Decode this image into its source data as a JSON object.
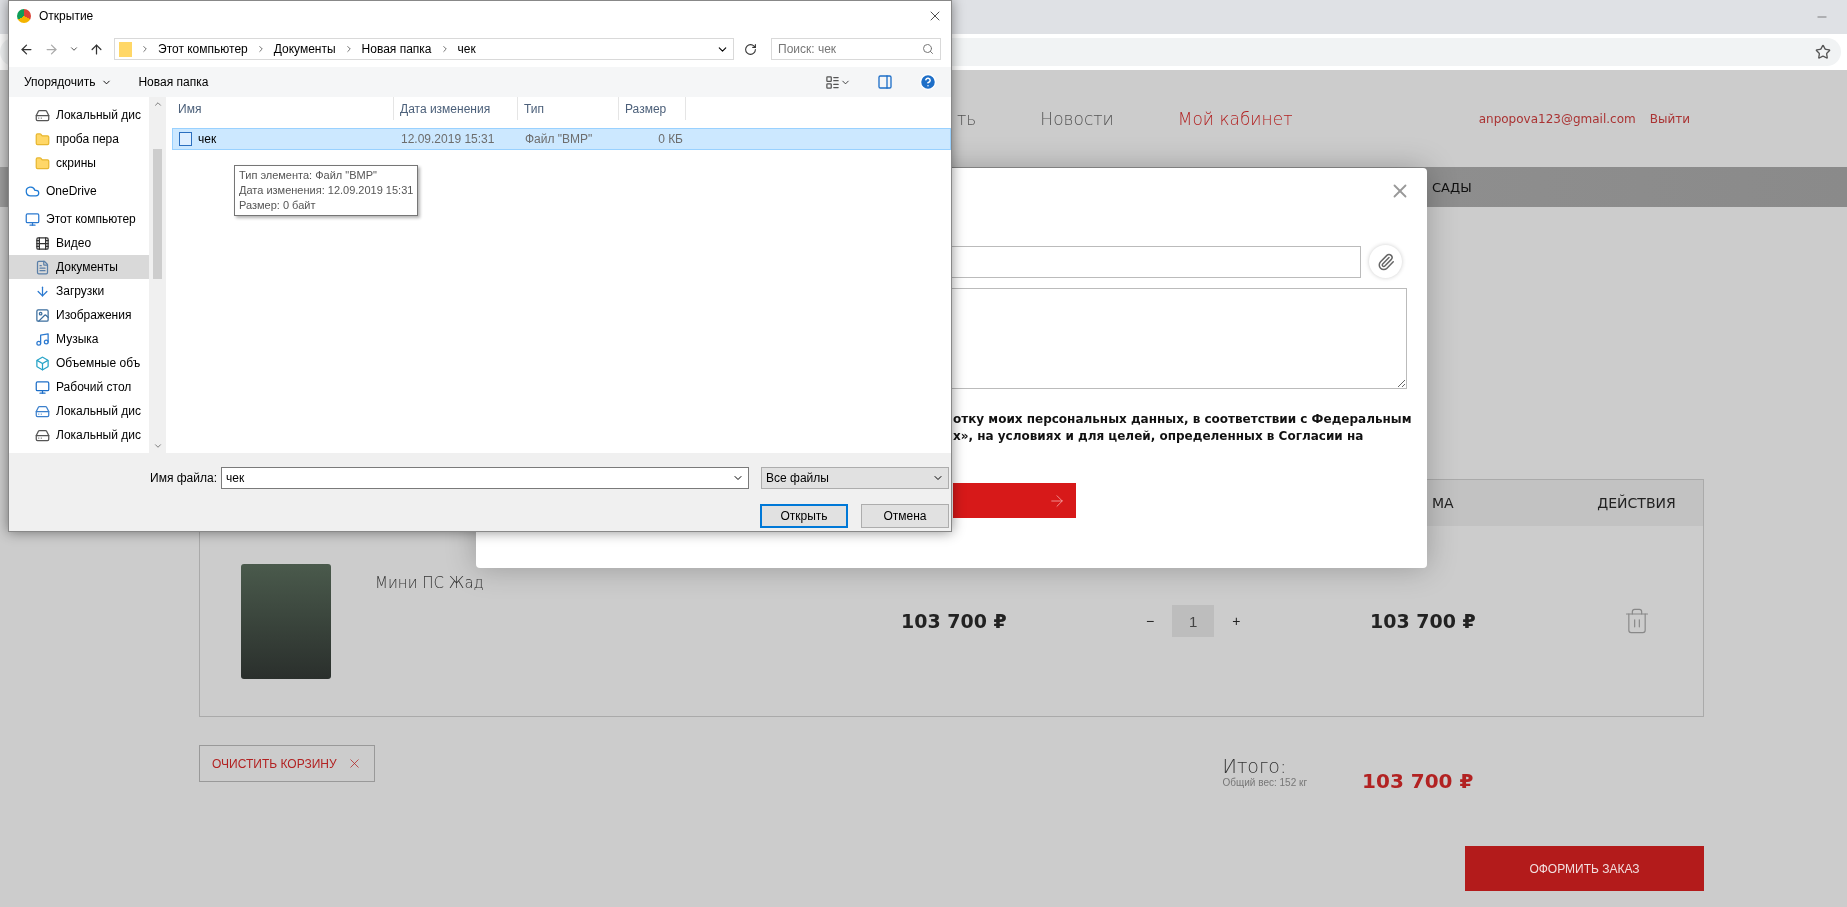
{
  "site": {
    "nav": [
      {
        "label": "ть",
        "selected": false
      },
      {
        "label": "Новости",
        "selected": false
      },
      {
        "label": "Мой кабинет",
        "selected": true
      }
    ],
    "user_email": "anpopova123@gmail.com",
    "logout": "Выйти",
    "menu": [
      "САДЫ"
    ]
  },
  "cart": {
    "columns": [
      "МА",
      "ДЕЙСТВИЯ"
    ],
    "items": [
      {
        "title": "Мини ПС Жад",
        "price": "103 700 ₽",
        "minus": "−",
        "quantity": "1",
        "plus": "+",
        "sum": "103 700 ₽"
      }
    ],
    "clear_button": "ОЧИСТИТЬ КОРЗИНУ",
    "total_label": "Итого:",
    "weight": "Общий вес: 152 кг",
    "total": "103 700 ₽",
    "checkout_button": "ОФОРМИТЬ ЗАКАЗ"
  },
  "modal": {
    "consent_lines": [
      "отку моих персональных данных, в соответствии с Федеральным",
      "х», на условиях и для целей, определенных в Согласии на"
    ]
  },
  "file_dialog": {
    "title": "Открытие",
    "breadcrumbs": [
      "Этот компьютер",
      "Документы",
      "Новая папка",
      "чек"
    ],
    "search": {
      "placeholder": "Поиск: чек"
    },
    "toolbar": [
      {
        "label": "Упорядочить",
        "menu": true
      },
      {
        "label": "Новая папка",
        "menu": false
      }
    ],
    "sidebar": {
      "scrolled_items": [
        {
          "label": "Локальный дис",
          "kind": "drive",
          "selected": false
        },
        {
          "label": "проба пера",
          "kind": "folder",
          "selected": false
        },
        {
          "label": "скрины",
          "kind": "folder",
          "selected": false
        }
      ],
      "items": [
        {
          "label": "OneDrive",
          "kind": "cloud",
          "selected": false
        },
        {
          "label": "Этот компьютер",
          "kind": "pc",
          "selected": false,
          "children": [
            {
              "label": "Видео",
              "kind": "video",
              "selected": false
            },
            {
              "label": "Документы",
              "kind": "docs",
              "selected": true
            },
            {
              "label": "Загрузки",
              "kind": "downloads",
              "selected": false
            },
            {
              "label": "Изображения",
              "kind": "pictures",
              "selected": false
            },
            {
              "label": "Музыка",
              "kind": "music",
              "selected": false
            },
            {
              "label": "Объемные объ",
              "kind": "objects",
              "selected": false
            },
            {
              "label": "Рабочий стол",
              "kind": "desktop",
              "selected": false
            },
            {
              "label": "Локальный дис",
              "kind": "netdrive",
              "selected": false
            },
            {
              "label": "Локальный дис",
              "kind": "drive",
              "selected": false
            }
          ]
        }
      ]
    },
    "columns": [
      "Имя",
      "Дата изменения",
      "Тип",
      "Размер"
    ],
    "files": [
      {
        "name": "чек",
        "date": "12.09.2019 15:31",
        "type": "Файл \"BMP\"",
        "size": "0 КБ",
        "selected": true
      }
    ],
    "tooltip": [
      "Тип элемента: Файл \"BMP\"",
      "Дата изменения: 12.09.2019 15:31",
      "Размер: 0 байт"
    ],
    "filename_label": "Имя файла:",
    "filename": "чек",
    "filter": "Все файлы",
    "buttons": [
      {
        "label": "Открыть",
        "default": true
      },
      {
        "label": "Отмена",
        "default": false
      }
    ]
  }
}
